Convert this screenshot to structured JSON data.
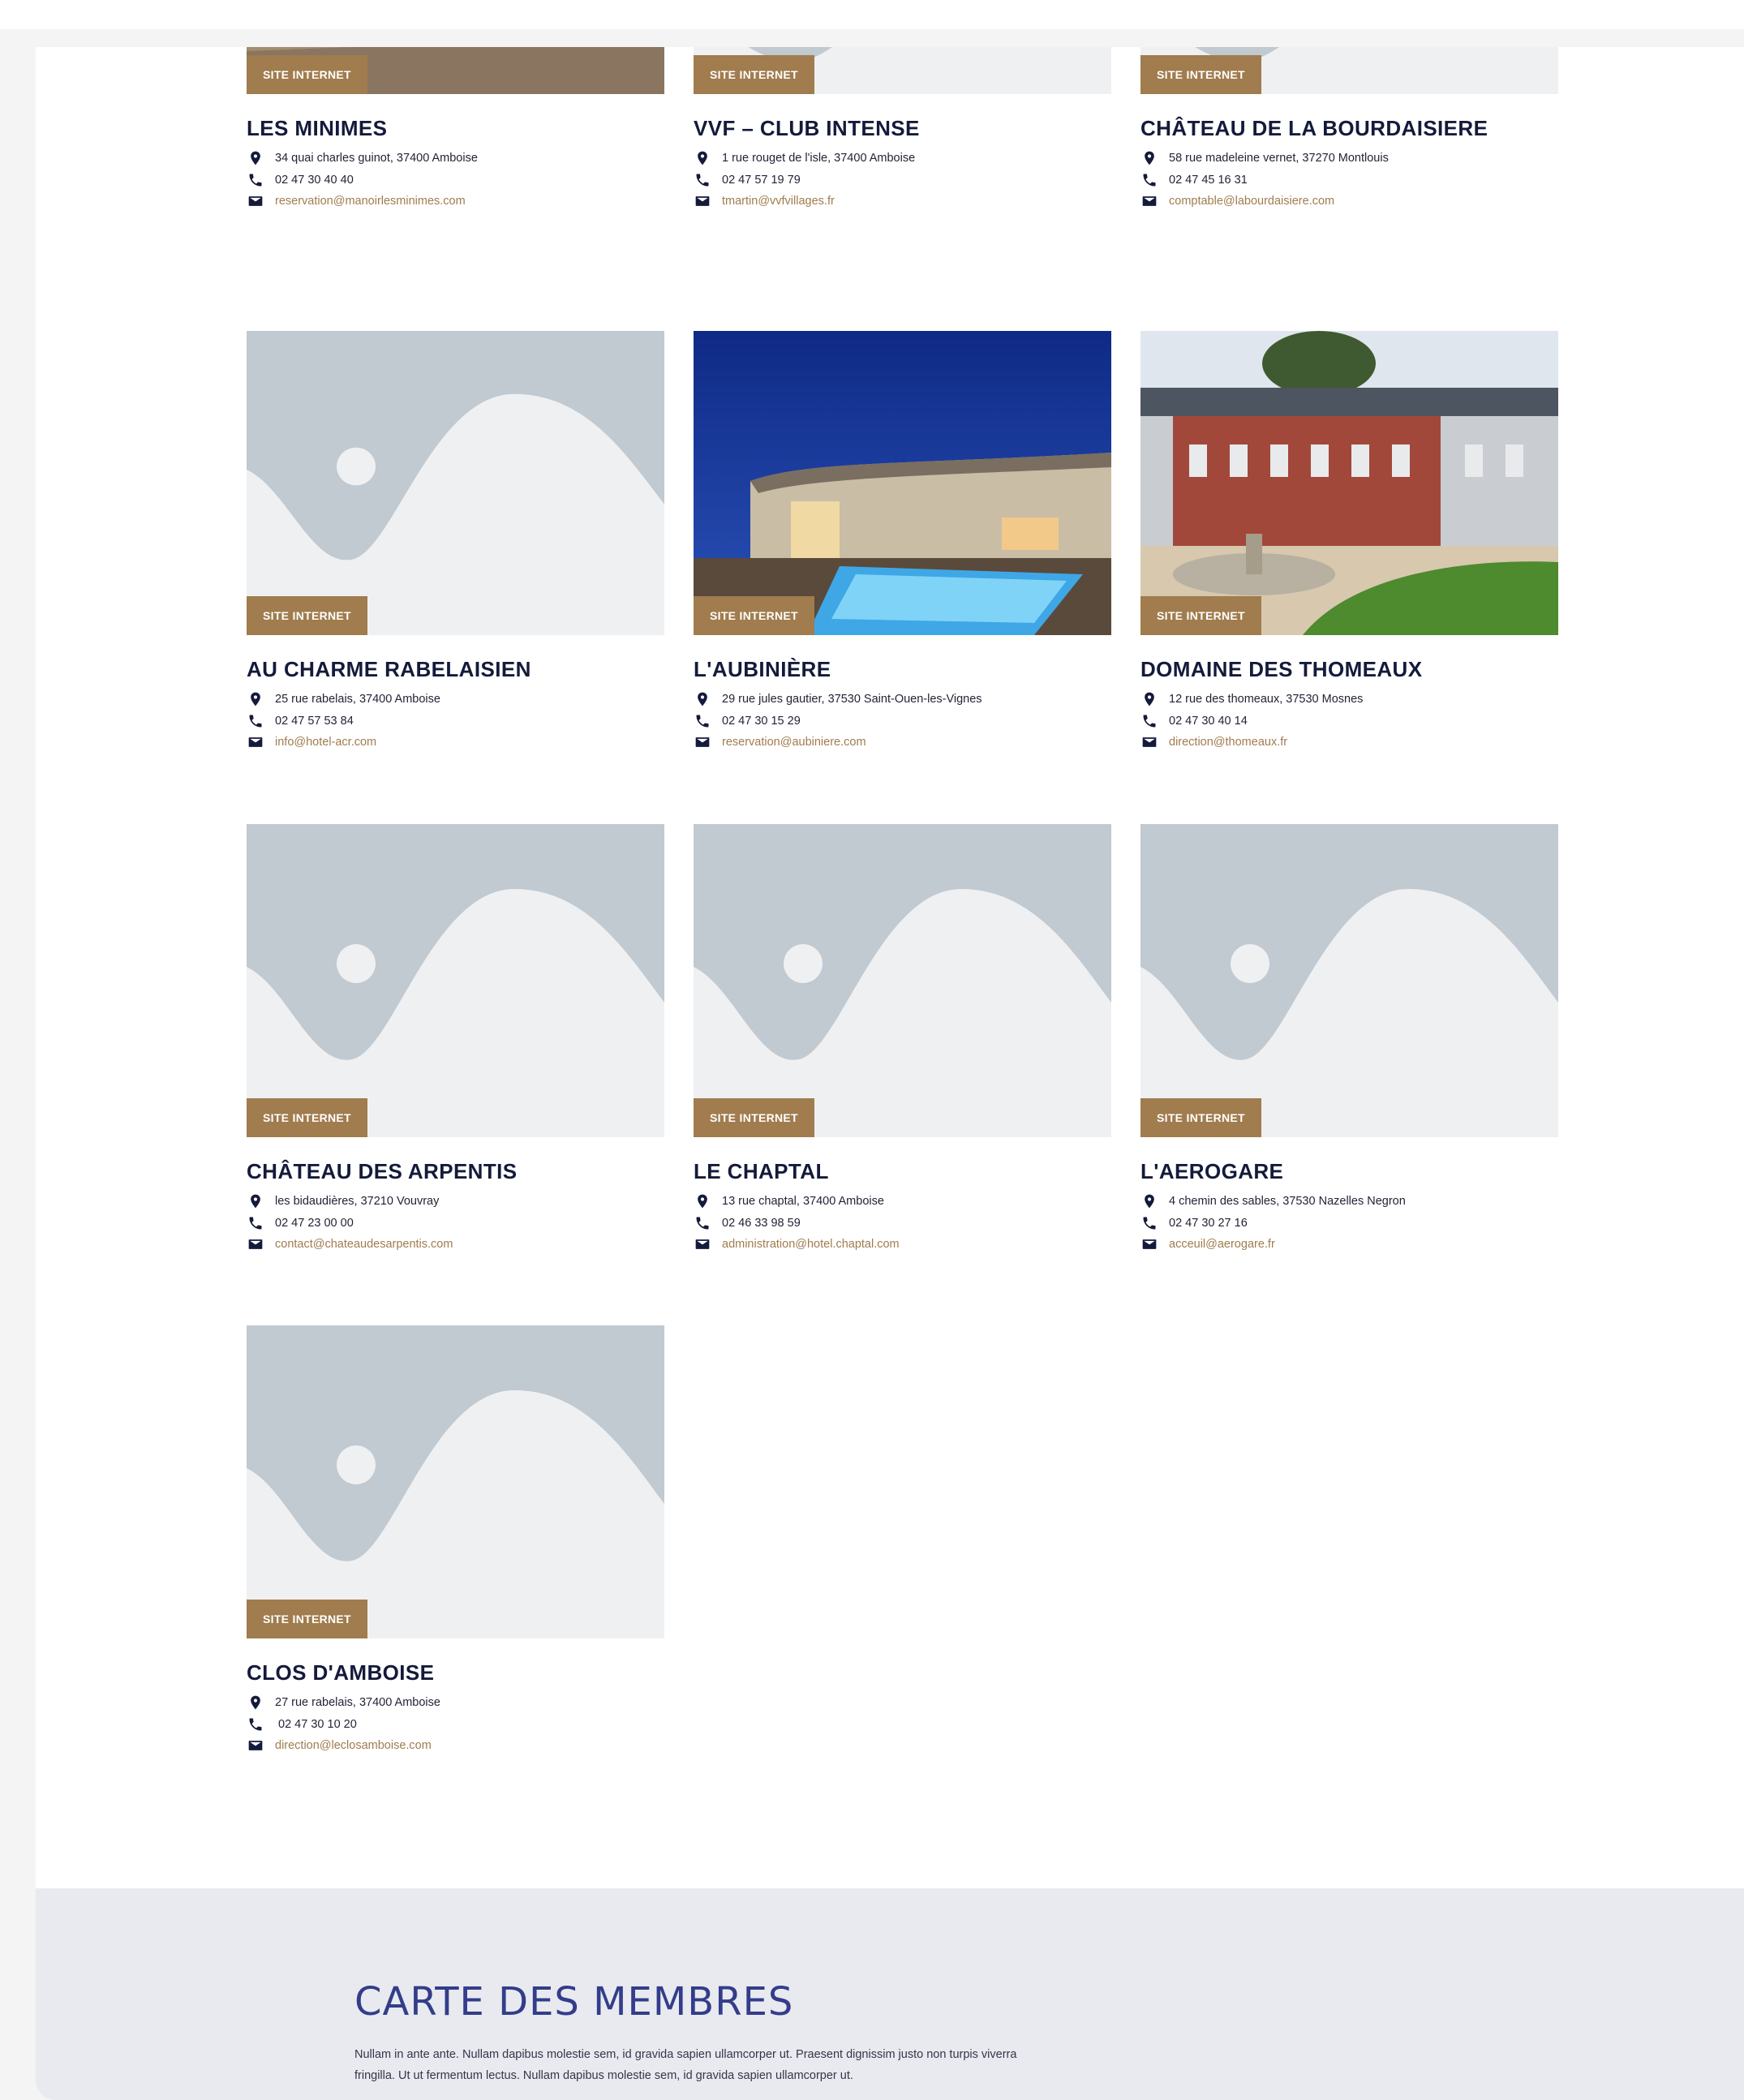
{
  "badge_label": "SITE INTERNET",
  "colors": {
    "badge": "#a07c4e",
    "title": "#141a3b",
    "email": "#a07c4e",
    "map_bg": "#e9eaf0",
    "map_title": "#333d8a"
  },
  "icons": {
    "address": "map-pin-icon",
    "phone": "phone-icon",
    "email": "envelope-icon"
  },
  "members": [
    {
      "name": "LES MINIMES",
      "address": "34 quai charles guinot, 37400 Amboise",
      "phone": "02 47 30 40 40",
      "email": "reservation@manoirlesminimes.com",
      "image": "photo-night-courtyard"
    },
    {
      "name": "VVF – CLUB INTENSE",
      "address": "1 rue rouget de l'isle, 37400 Amboise",
      "phone": "02 47 57 19 79",
      "email": "tmartin@vvfvillages.fr",
      "image": "placeholder"
    },
    {
      "name": "CHÂTEAU DE LA BOURDAISIERE",
      "address": "58 rue madeleine vernet, 37270 Montlouis",
      "phone": "02 47 45 16 31",
      "email": "comptable@labourdaisiere.com",
      "image": "placeholder"
    },
    {
      "name": "AU CHARME RABELAISIEN",
      "address": "25 rue rabelais, 37400 Amboise",
      "phone": "02 47 57 53 84",
      "email": "info@hotel-acr.com",
      "image": "placeholder"
    },
    {
      "name": "L'AUBINIÈRE",
      "address": "29 rue jules gautier, 37530 Saint-Ouen-les-Vignes",
      "phone": "02 47 30 15 29",
      "email": "reservation@aubiniere.com",
      "image": "photo-pool-night"
    },
    {
      "name": "DOMAINE DES THOMEAUX",
      "address": "12 rue des thomeaux, 37530 Mosnes",
      "phone": "02 47 30 40 14",
      "email": "direction@thomeaux.fr",
      "image": "photo-manor-fountain"
    },
    {
      "name": "CHÂTEAU DES ARPENTIS",
      "address": "les bidaudières, 37210 Vouvray",
      "phone": "02 47 23 00 00",
      "email": "contact@chateaudesarpentis.com",
      "image": "placeholder"
    },
    {
      "name": "LE CHAPTAL",
      "address": "13 rue chaptal, 37400 Amboise",
      "phone": "02 46 33 98 59",
      "email": "administration@hotel.chaptal.com",
      "image": "placeholder"
    },
    {
      "name": "L'AEROGARE",
      "address": "4 chemin des sables, 37530 Nazelles Negron",
      "phone": "02 47 30 27 16",
      "email": "acceuil@aerogare.fr",
      "image": "placeholder"
    },
    {
      "name": "CLOS D'AMBOISE",
      "address": "27 rue rabelais, 37400 Amboise",
      "phone": " 02 47 30 10 20",
      "email": "direction@leclosamboise.com",
      "image": "placeholder"
    }
  ],
  "map_section": {
    "title": "CARTE DES MEMBRES",
    "text": "Nullam in ante ante. Nullam dapibus molestie sem, id gravida sapien ullamcorper ut. Praesent dignissim justo non turpis viverra fringilla. Ut ut fermentum lectus. Nullam dapibus molestie sem, id gravida sapien ullamcorper ut."
  }
}
